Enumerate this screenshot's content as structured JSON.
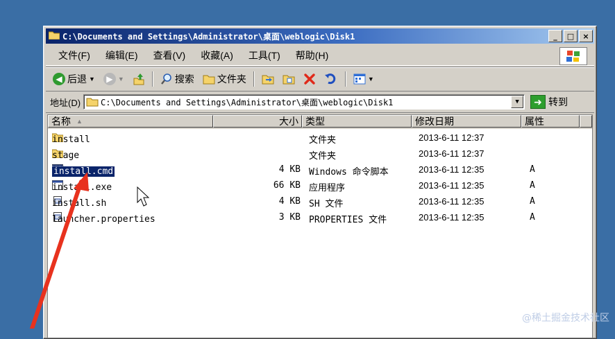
{
  "window": {
    "title": "C:\\Documents and Settings\\Administrator\\桌面\\weblogic\\Disk1",
    "controls": [
      "_",
      "□",
      "×"
    ]
  },
  "menu": [
    "文件(F)",
    "编辑(E)",
    "查看(V)",
    "收藏(A)",
    "工具(T)",
    "帮助(H)"
  ],
  "toolbar": {
    "back": "后退",
    "search": "搜索",
    "folders": "文件夹"
  },
  "address": {
    "label": "地址(D)",
    "value": "C:\\Documents and Settings\\Administrator\\桌面\\weblogic\\Disk1",
    "go": "转到"
  },
  "columns": {
    "name": "名称",
    "size": "大小",
    "type": "类型",
    "date": "修改日期",
    "attr": "属性"
  },
  "files": [
    {
      "name": "install",
      "size": "",
      "type": "文件夹",
      "date": "2013-6-11 12:37",
      "attr": "",
      "icon": "folder-icon"
    },
    {
      "name": "stage",
      "size": "",
      "type": "文件夹",
      "date": "2013-6-11 12:37",
      "attr": "",
      "icon": "folder-icon"
    },
    {
      "name": "install.cmd",
      "size": "4 KB",
      "type": "Windows 命令脚本",
      "date": "2013-6-11 12:35",
      "attr": "A",
      "icon": "cmd-script-icon",
      "selected": true
    },
    {
      "name": "install.exe",
      "size": "66 KB",
      "type": "应用程序",
      "date": "2013-6-11 12:35",
      "attr": "A",
      "icon": "application-icon"
    },
    {
      "name": "install.sh",
      "size": "4 KB",
      "type": "SH 文件",
      "date": "2013-6-11 12:35",
      "attr": "A",
      "icon": "file-icon"
    },
    {
      "name": "launcher.properties",
      "size": "3 KB",
      "type": "PROPERTIES 文件",
      "date": "2013-6-11 12:35",
      "attr": "A",
      "icon": "file-icon"
    }
  ],
  "watermark": "@稀土掘金技术社区",
  "colors": {
    "desktop": "#3a6ea5",
    "titlebar": "#0a246a",
    "selection": "#0a246a",
    "annotation_arrow": "#e8321e"
  }
}
